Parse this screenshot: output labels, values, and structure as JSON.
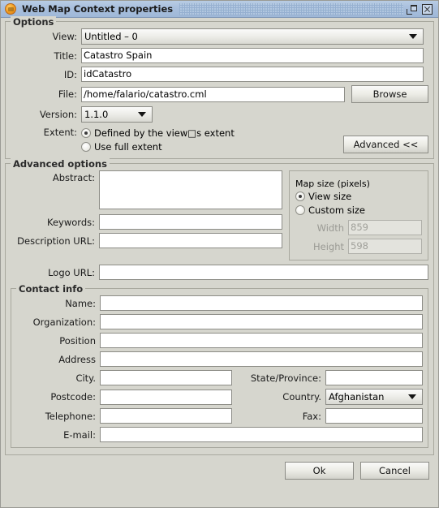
{
  "window": {
    "title": "Web Map Context properties",
    "icon": "app-globe-icon",
    "restore_label": "Restore",
    "close_label": "Close"
  },
  "options": {
    "legend": "Options",
    "view": {
      "label": "View:",
      "value": "Untitled – 0"
    },
    "title": {
      "label": "Title:",
      "value": "Catastro Spain"
    },
    "id": {
      "label": "ID:",
      "value": "idCatastro"
    },
    "file": {
      "label": "File:",
      "value": "/home/falario/catastro.cml"
    },
    "browse_label": "Browse",
    "version": {
      "label": "Version:",
      "value": "1.1.0"
    },
    "extent": {
      "label": "Extent:",
      "option_view": "Defined by the view□s extent",
      "option_full": "Use full extent",
      "selected": "view"
    },
    "advanced_label": "Advanced  <<"
  },
  "advanced": {
    "legend": "Advanced options",
    "abstract": {
      "label": "Abstract:",
      "value": ""
    },
    "keywords": {
      "label": "Keywords:",
      "value": ""
    },
    "description_url": {
      "label": "Description URL:",
      "value": ""
    },
    "logo_url": {
      "label": "Logo URL:",
      "value": ""
    },
    "map_size": {
      "legend": "Map size (pixels)",
      "option_view": "View size",
      "option_custom": "Custom size",
      "selected": "view",
      "width": {
        "label": "Width",
        "value": "859",
        "disabled": true
      },
      "height": {
        "label": "Height",
        "value": "598",
        "disabled": true
      }
    }
  },
  "contact": {
    "legend": "Contact info",
    "name": {
      "label": "Name:",
      "value": ""
    },
    "organization": {
      "label": "Organization:",
      "value": ""
    },
    "position": {
      "label": "Position",
      "value": ""
    },
    "address": {
      "label": "Address",
      "value": ""
    },
    "city": {
      "label": "City.",
      "value": ""
    },
    "state": {
      "label": "State/Province:",
      "value": ""
    },
    "postcode": {
      "label": "Postcode:",
      "value": ""
    },
    "country": {
      "label": "Country.",
      "value": "Afghanistan"
    },
    "telephone": {
      "label": "Telephone:",
      "value": ""
    },
    "fax": {
      "label": "Fax:",
      "value": ""
    },
    "email": {
      "label": "E-mail:",
      "value": ""
    }
  },
  "footer": {
    "ok_label": "Ok",
    "cancel_label": "Cancel"
  }
}
